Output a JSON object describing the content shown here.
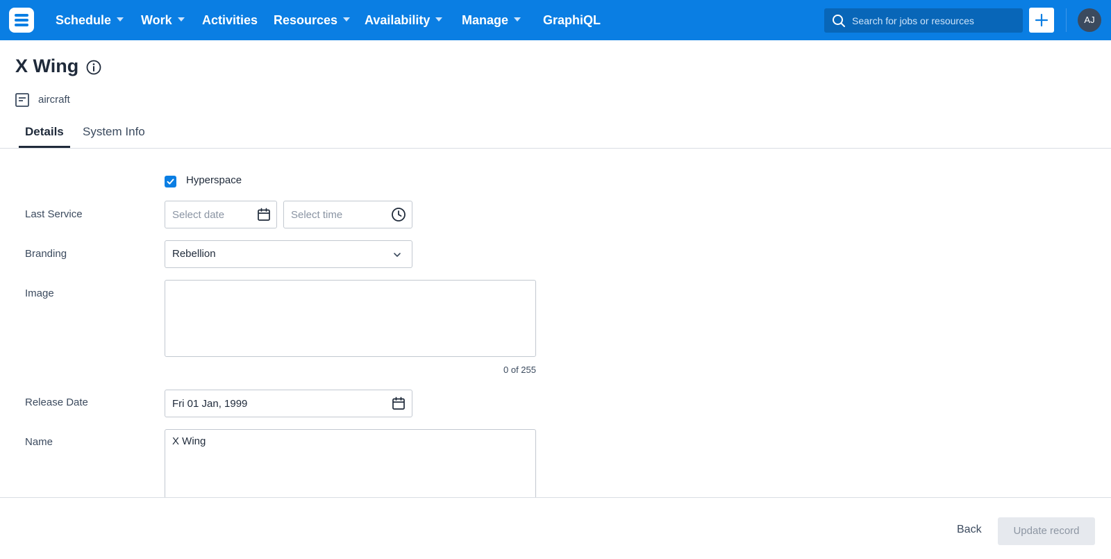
{
  "nav": {
    "items": [
      {
        "label": "Schedule",
        "dropdown": true
      },
      {
        "label": "Work",
        "dropdown": true
      },
      {
        "label": "Activities",
        "dropdown": false
      },
      {
        "label": "Resources",
        "dropdown": true
      },
      {
        "label": "Availability",
        "dropdown": true
      },
      {
        "label": "Manage",
        "dropdown": true
      },
      {
        "label": "GraphiQL",
        "dropdown": false
      }
    ],
    "search_placeholder": "Search for jobs or resources",
    "avatar_initials": "AJ"
  },
  "header": {
    "title": "X Wing",
    "type_label": "aircraft"
  },
  "tabs": [
    {
      "label": "Details",
      "active": true
    },
    {
      "label": "System Info",
      "active": false
    }
  ],
  "form": {
    "hyperspace": {
      "label": "Hyperspace",
      "checked": true
    },
    "last_service": {
      "label": "Last Service",
      "date_placeholder": "Select date",
      "time_placeholder": "Select time"
    },
    "branding": {
      "label": "Branding",
      "value": "Rebellion"
    },
    "image": {
      "label": "Image",
      "value": "",
      "counter": "0 of 255"
    },
    "release_date": {
      "label": "Release Date",
      "value": "Fri 01 Jan, 1999"
    },
    "name": {
      "label": "Name",
      "value": "X Wing"
    }
  },
  "footer": {
    "back_label": "Back",
    "update_label": "Update record"
  },
  "colors": {
    "brand": "#0a7ee3",
    "text": "#1f2a3a",
    "muted": "#3b4a5e",
    "disabled_bg": "#e6e9ee"
  },
  "icons": [
    "menu-logo-icon",
    "caret-down-icon",
    "search-icon",
    "plus-icon",
    "info-icon",
    "document-icon",
    "checkmark-icon",
    "calendar-icon",
    "clock-icon",
    "chevron-down-icon"
  ]
}
